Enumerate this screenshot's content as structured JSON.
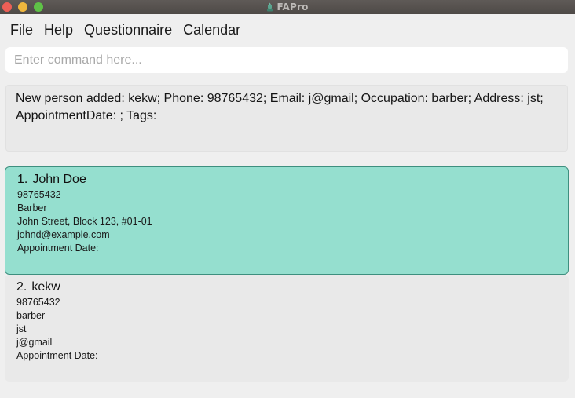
{
  "window": {
    "title": "FAPro"
  },
  "menu": {
    "items": [
      "File",
      "Help",
      "Questionnaire",
      "Calendar"
    ]
  },
  "command": {
    "placeholder": "Enter command here...",
    "value": ""
  },
  "result": {
    "text": "New person added: kekw; Phone: 98765432; Email: j@gmail; Occupation: barber; Address: jst; AppointmentDate: ; Tags:"
  },
  "persons": [
    {
      "index": "1.",
      "name": "John Doe",
      "phone": "98765432",
      "occupation": "Barber",
      "address": "John Street, Block 123, #01-01",
      "email": "johnd@example.com",
      "appointment": "Appointment Date:"
    },
    {
      "index": "2.",
      "name": "kekw",
      "phone": "98765432",
      "occupation": "barber",
      "address": "jst",
      "email": "j@gmail",
      "appointment": "Appointment Date:"
    }
  ],
  "colors": {
    "selected_card": "#95dfcf",
    "selected_border": "#3e8f7f",
    "background": "#efefef"
  }
}
